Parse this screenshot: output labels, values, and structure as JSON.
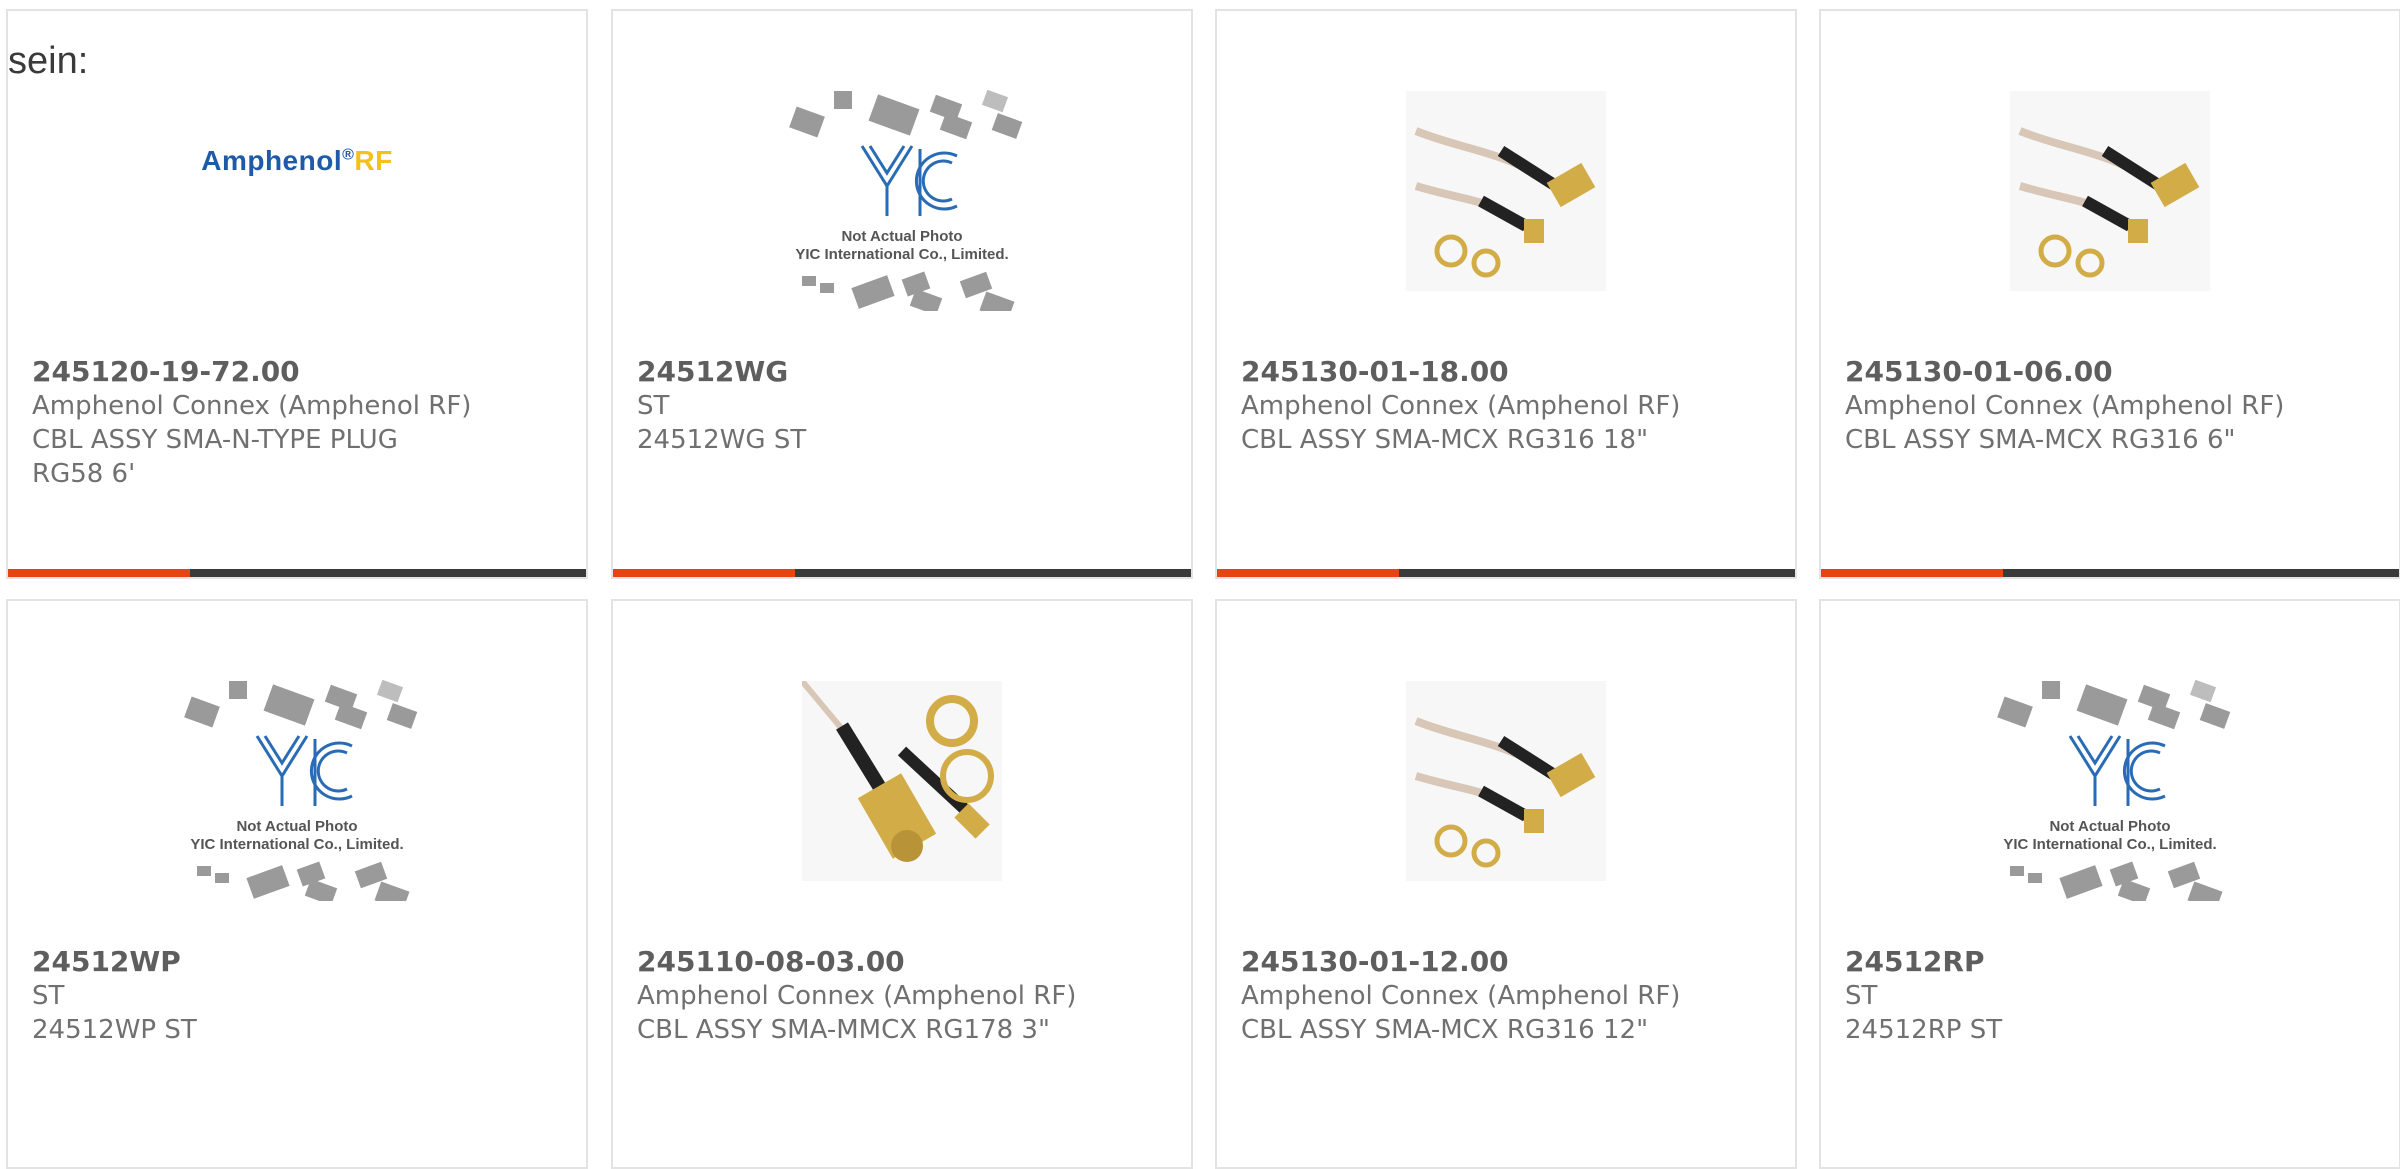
{
  "intro_text": "sein:",
  "colors": {
    "accent": "#e84215",
    "bar": "#3a3a3a",
    "logo_blue": "#1f5aa8",
    "logo_yellow": "#f2c21b"
  },
  "cards": [
    {
      "part": "245120-19-72.00",
      "line1": "Amphenol Connex (Amphenol RF)",
      "line2": "CBL ASSY SMA-N-TYPE PLUG",
      "line3": "RG58 6'",
      "image": "amphenol-rf-logo",
      "logo_main": "Amphenol",
      "logo_reg": "®",
      "logo_rf": "RF"
    },
    {
      "part": "24512WG",
      "line1": "ST",
      "line2": "24512WG ST",
      "line3": "",
      "image": "yic-placeholder",
      "yic_text1": "Not Actual Photo",
      "yic_text2": "YIC International Co., Limited."
    },
    {
      "part": "245130-01-18.00",
      "line1": "Amphenol Connex (Amphenol RF)",
      "line2": "CBL ASSY SMA-MCX RG316 18\"",
      "line3": "",
      "image": "cable-assembly-photo"
    },
    {
      "part": "245130-01-06.00",
      "line1": "Amphenol Connex (Amphenol RF)",
      "line2": "CBL ASSY SMA-MCX RG316 6\"",
      "line3": "",
      "image": "cable-assembly-photo"
    },
    {
      "part": "24512WP",
      "line1": "ST",
      "line2": "24512WP ST",
      "line3": "",
      "image": "yic-placeholder",
      "yic_text1": "Not Actual Photo",
      "yic_text2": "YIC International Co., Limited."
    },
    {
      "part": "245110-08-03.00",
      "line1": "Amphenol Connex (Amphenol RF)",
      "line2": "CBL ASSY SMA-MMCX RG178 3\"",
      "line3": "",
      "image": "cable-mmcx-photo"
    },
    {
      "part": "245130-01-12.00",
      "line1": "Amphenol Connex (Amphenol RF)",
      "line2": "CBL ASSY SMA-MCX RG316 12\"",
      "line3": "",
      "image": "cable-assembly-photo"
    },
    {
      "part": "24512RP",
      "line1": "ST",
      "line2": "24512RP ST",
      "line3": "",
      "image": "yic-placeholder",
      "yic_text1": "Not Actual Photo",
      "yic_text2": "YIC International Co., Limited."
    }
  ]
}
